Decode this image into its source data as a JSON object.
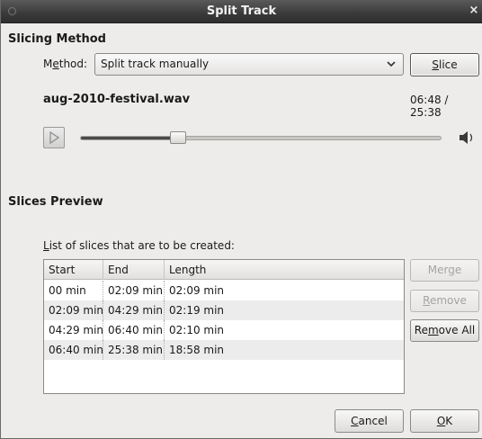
{
  "window": {
    "title": "Split Track",
    "close_label": "×"
  },
  "slicing": {
    "heading": "Slicing Method",
    "method_label_pre": "M",
    "method_label_u": "e",
    "method_label_post": "thod:",
    "method_value": "Split track manually",
    "slice_button_u": "S",
    "slice_button_post": "lice"
  },
  "track": {
    "filename": "aug-2010-festival.wav",
    "time": "06:48 / 25:38",
    "position_fraction": 0.27
  },
  "preview": {
    "heading": "Slices Preview",
    "list_label_u": "L",
    "list_label_post": "ist of slices that are to be created:",
    "columns": [
      "Start",
      "End",
      "Length"
    ],
    "rows": [
      [
        "00 min",
        "02:09 min",
        "02:09 min"
      ],
      [
        "02:09 min",
        "04:29 min",
        "02:19 min"
      ],
      [
        "04:29 min",
        "06:40 min",
        "02:10 min"
      ],
      [
        "06:40 min",
        "25:38 min",
        "18:58 min"
      ]
    ],
    "merge_pre": "Mer",
    "merge_u": "g",
    "merge_post": "e",
    "remove_u": "R",
    "remove_post": "emove",
    "remove_all_pre": "Re",
    "remove_all_u": "m",
    "remove_all_post": "ove All"
  },
  "footer": {
    "cancel_u": "C",
    "cancel_post": "ancel",
    "ok_u": "O",
    "ok_post": "K"
  }
}
